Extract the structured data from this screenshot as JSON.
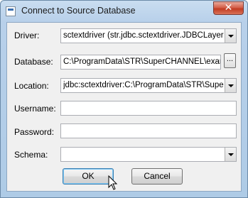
{
  "window": {
    "title": "Connect to Source Database",
    "close_glyph": "✕"
  },
  "form": {
    "driver": {
      "label": "Driver:",
      "value": "sctextdriver  (str.jdbc.sctextdriver.JDBCLayer.SC"
    },
    "database": {
      "label": "Database:",
      "value": "C:\\ProgramData\\STR\\SuperCHANNEL\\examp",
      "browse_label": "..."
    },
    "location": {
      "label": "Location:",
      "value": "jdbc:sctextdriver:C:\\ProgramData\\STR\\SuperC"
    },
    "username": {
      "label": "Username:",
      "value": ""
    },
    "password": {
      "label": "Password:",
      "value": ""
    },
    "schema": {
      "label": "Schema:",
      "value": ""
    }
  },
  "buttons": {
    "ok_label": "OK",
    "cancel_label": "Cancel"
  },
  "icons": {
    "app": "database-app-icon",
    "close": "close-icon",
    "dropdown": "chevron-down-icon",
    "cursor": "mouse-pointer-icon"
  }
}
